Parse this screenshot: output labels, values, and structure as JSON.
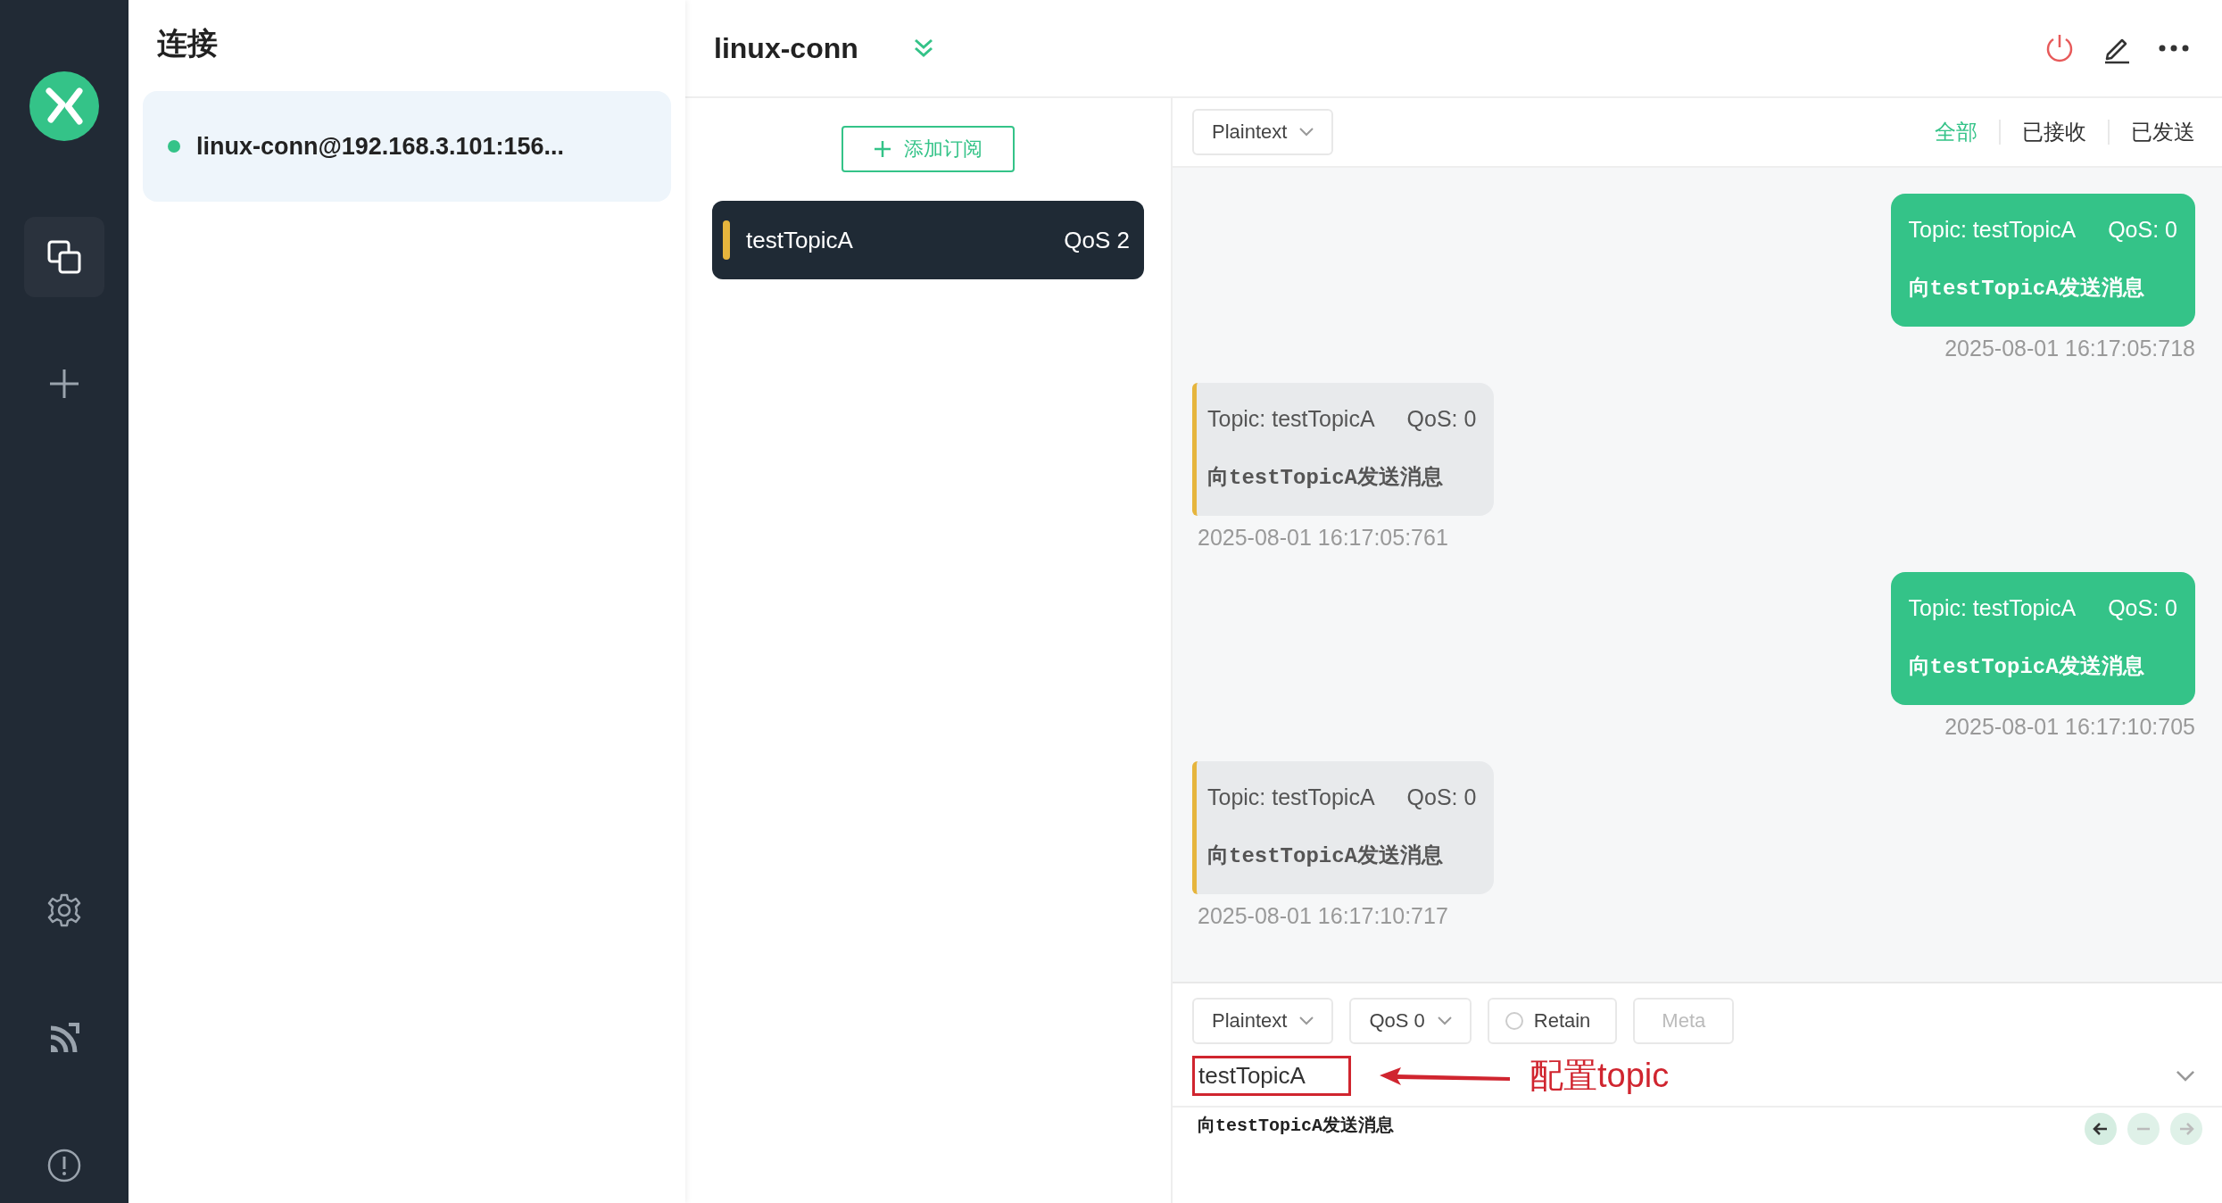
{
  "nav": {
    "items": [
      {
        "kind": "connections",
        "selected": true
      },
      {
        "kind": "new",
        "selected": false
      },
      {
        "kind": "settings",
        "selected": false
      },
      {
        "kind": "feed",
        "selected": false
      },
      {
        "kind": "about",
        "selected": false
      }
    ]
  },
  "connections_panel": {
    "title": "连接",
    "connections": [
      {
        "name": "linux-conn@192.168.3.101:156...",
        "color": "#34c388",
        "selected": true
      }
    ]
  },
  "header": {
    "title": "linux-conn"
  },
  "subscriptions": {
    "add_button": "添加订阅",
    "items": [
      {
        "topic": "testTopicA",
        "qos": "QoS 2",
        "color": "#e6b53d",
        "selected": true
      }
    ]
  },
  "messages": {
    "format": "Plaintext",
    "filters": [
      {
        "label": "全部",
        "selected": true
      },
      {
        "label": "已接收",
        "selected": false
      },
      {
        "label": "已发送",
        "selected": false
      }
    ],
    "items": [
      {
        "kind": "sent",
        "topic": "Topic: testTopicA",
        "qos": "QoS: 0",
        "payload": "向testTopicA发送消息",
        "time": "2025-08-01 16:17:05:718"
      },
      {
        "kind": "received",
        "topic": "Topic: testTopicA",
        "qos": "QoS: 0",
        "payload": "向testTopicA发送消息",
        "time": "2025-08-01 16:17:05:761"
      },
      {
        "kind": "sent",
        "topic": "Topic: testTopicA",
        "qos": "QoS: 0",
        "payload": "向testTopicA发送消息",
        "time": "2025-08-01 16:17:10:705"
      },
      {
        "kind": "received",
        "topic": "Topic: testTopicA",
        "qos": "QoS: 0",
        "payload": "向testTopicA发送消息",
        "time": "2025-08-01 16:17:10:717"
      }
    ]
  },
  "composer": {
    "format": "Plaintext",
    "qos": "QoS 0",
    "retain": {
      "label": "Retain",
      "checked": false
    },
    "meta": {
      "label": "Meta",
      "disabled": true
    },
    "topic": {
      "value": "testTopicA",
      "highlighted": true
    },
    "annotation": "配置topic",
    "payload": "向testTopicA发送消息"
  }
}
